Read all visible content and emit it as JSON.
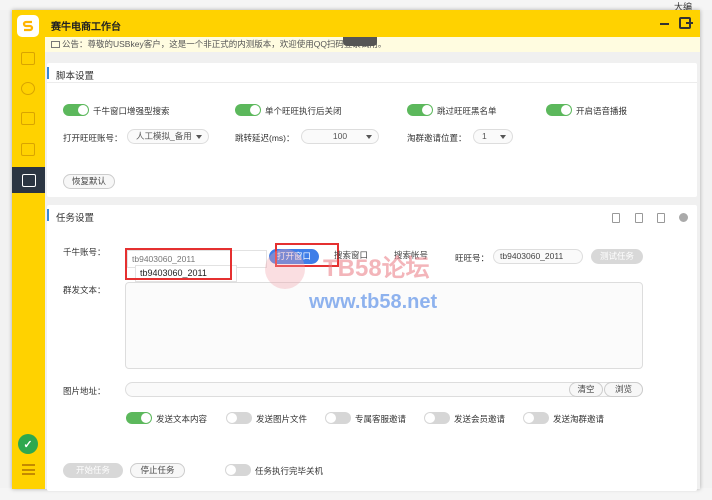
{
  "window": {
    "title": "赛牛电商工作台",
    "outer_right_text": "大编"
  },
  "notice": {
    "text": "公告：尊敬的USBkey客户，这是一个非正式的内测版本，欢迎使用QQ扫码登录试用。"
  },
  "script_settings": {
    "title": "脚本设置",
    "toggles": [
      {
        "label": "千牛窗口增强型搜索",
        "on": true
      },
      {
        "label": "单个旺旺执行后关闭",
        "on": true
      },
      {
        "label": "跳过旺旺黑名单",
        "on": true
      },
      {
        "label": "开启语音播报",
        "on": true
      }
    ],
    "open_account_label": "打开旺旺账号：",
    "open_account_value": "人工模拟_备用",
    "delay_label": "跳转延迟(ms)：",
    "delay_value": "100",
    "group_pos_label": "淘群邀请位置：",
    "group_pos_value": "1",
    "restore_button": "恢复默认"
  },
  "task_settings": {
    "title": "任务设置",
    "account_label": "千牛账号：",
    "account_value": "tb9403060_2011",
    "dropdown_option": "tb9403060_2011",
    "chip_buttons": [
      "打开窗口",
      "搜索窗口",
      "搜索帐号"
    ],
    "wangwang_label": "旺旺号：",
    "wangwang_value": "tb9403060_2011",
    "test_button": "测试任务",
    "group_text_label": "群发文本：",
    "image_label": "图片地址：",
    "clear_button": "清空",
    "browse_button": "浏览",
    "options": [
      {
        "label": "发送文本内容",
        "on": true
      },
      {
        "label": "发送图片文件",
        "on": false
      },
      {
        "label": "专属客服邀请",
        "on": false
      },
      {
        "label": "发送会员邀请",
        "on": false
      },
      {
        "label": "发送淘群邀请",
        "on": false
      }
    ],
    "start_button": "开始任务",
    "stop_button": "停止任务",
    "shutdown_label": "任务执行完毕关机"
  },
  "watermark": {
    "text": "TB58论坛",
    "url": "www.tb58.net"
  },
  "colors": {
    "brand": "#ffd200",
    "toggle_on": "#5cb85c",
    "accent": "#3f7ee8",
    "highlight": "#e53030"
  }
}
